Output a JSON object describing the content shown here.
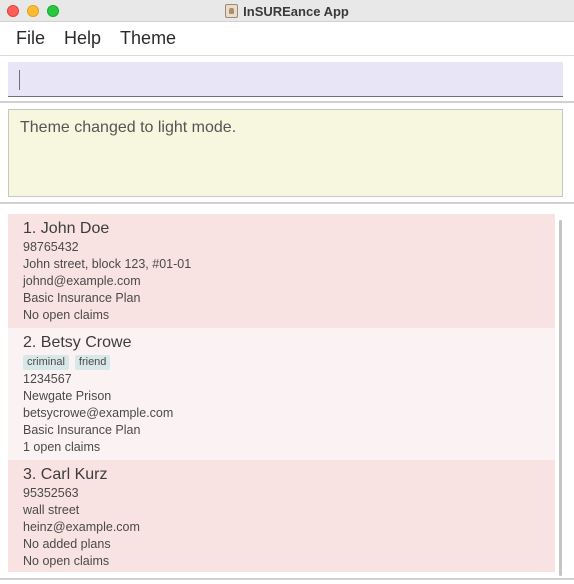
{
  "window": {
    "title": "InSUREance App"
  },
  "menu": {
    "items": [
      "File",
      "Help",
      "Theme"
    ]
  },
  "command": {
    "value": "",
    "placeholder": ""
  },
  "result": {
    "message": "Theme changed to light mode."
  },
  "persons": [
    {
      "name": "1. John Doe",
      "tags": [],
      "details": [
        "98765432",
        "John street, block 123, #01-01",
        "johnd@example.com",
        "Basic Insurance Plan",
        "No open claims"
      ]
    },
    {
      "name": "2. Betsy Crowe",
      "tags": [
        "criminal",
        "friend"
      ],
      "details": [
        "1234567",
        "Newgate Prison",
        "betsycrowe@example.com",
        "Basic Insurance Plan",
        "1 open claims"
      ]
    },
    {
      "name": "3. Carl Kurz",
      "tags": [],
      "details": [
        "95352563",
        "wall street",
        "heinz@example.com",
        "No added plans",
        "No open claims"
      ]
    }
  ],
  "colors": {
    "card_odd": "#f8e2e2",
    "card_even": "#fbf3f3",
    "command_box": "#e8e6f6",
    "result_box": "#f7f6df",
    "tag": "#d8e8e8"
  },
  "icons": {
    "app": "app-icon",
    "close": "close-window-icon",
    "minimize": "minimize-window-icon",
    "maximize": "maximize-window-icon"
  }
}
